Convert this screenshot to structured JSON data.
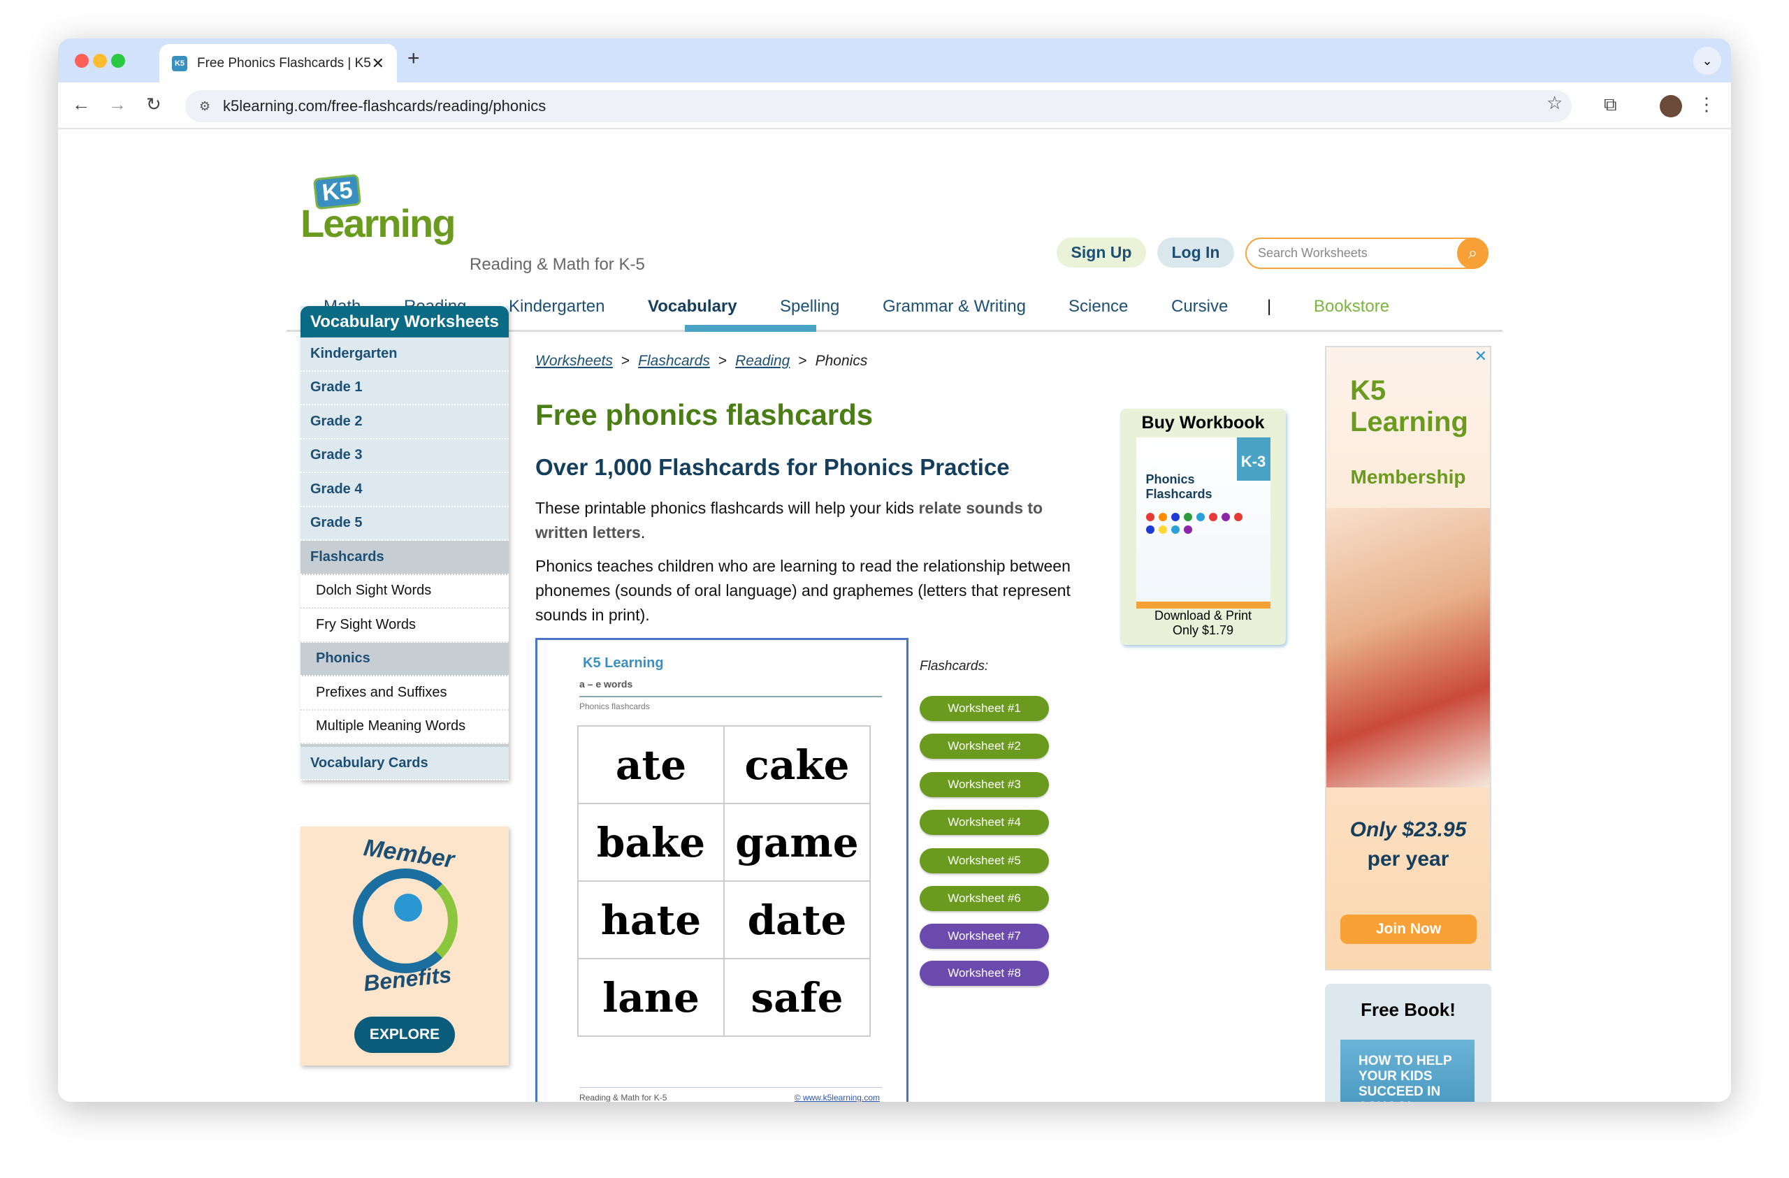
{
  "browser": {
    "tab_title": "Free Phonics Flashcards | K5",
    "url": "k5learning.com/free-flashcards/reading/phonics"
  },
  "header": {
    "logo_text": "K5 Learning",
    "tagline": "Reading & Math for K-5",
    "sign_up": "Sign Up",
    "log_in": "Log In",
    "search_placeholder": "Search Worksheets"
  },
  "nav": [
    "Math",
    "Reading",
    "Kindergarten",
    "Vocabulary",
    "Spelling",
    "Grammar & Writing",
    "Science",
    "Cursive",
    "|",
    "Bookstore"
  ],
  "nav_active": "Vocabulary",
  "sidebar": {
    "title": "Vocabulary Worksheets",
    "grades": [
      "Kindergarten",
      "Grade 1",
      "Grade 2",
      "Grade 3",
      "Grade 4",
      "Grade 5"
    ],
    "flashcards": "Flashcards",
    "sub": [
      "Dolch Sight Words",
      "Fry Sight Words",
      "Phonics",
      "Prefixes and Suffixes",
      "Multiple Meaning Words"
    ],
    "vocab_cards": "Vocabulary Cards"
  },
  "member": {
    "top": "Member",
    "bottom": "Benefits",
    "explore": "EXPLORE"
  },
  "breadcrumb": [
    "Worksheets",
    "Flashcards",
    "Reading",
    "Phonics"
  ],
  "main": {
    "title": "Free phonics flashcards",
    "subtitle": "Over 1,000 Flashcards for Phonics Practice",
    "p1_a": "These printable phonics flashcards will help your kids ",
    "p1_b": "relate sounds to written letters",
    "p1_c": ".",
    "p2": "Phonics teaches children who are learning to read the relationship between phonemes (sounds of oral language) and graphemes (letters that represent sounds in print)."
  },
  "sheet": {
    "logo": "K5 Learning",
    "title": "a – e words",
    "subtitle": "Phonics flashcards",
    "words": [
      "ate",
      "cake",
      "bake",
      "game",
      "hate",
      "date",
      "lane",
      "safe"
    ],
    "footer_left": "Reading & Math for K-5",
    "footer_right": "© www.k5learning.com"
  },
  "flashcards": {
    "label": "Flashcards:",
    "buttons": [
      "Worksheet #1",
      "Worksheet #2",
      "Worksheet #3",
      "Worksheet #4",
      "Worksheet #5",
      "Worksheet #6",
      "Worksheet #7",
      "Worksheet #8"
    ],
    "green": "#6a9b1e",
    "purple": "#6a4aad"
  },
  "workbook": {
    "title": "Buy Workbook",
    "grade": "K-3",
    "cover_title": "Phonics Flashcards",
    "line1": "Download & Print",
    "line2": "Only $1.79"
  },
  "ad": {
    "logo": "K5 Learning",
    "heading": "Membership",
    "price": "Only $23.95",
    "period": "per year",
    "cta": "Join Now"
  },
  "freebook": {
    "title": "Free Book!",
    "book": "HOW TO HELP YOUR KIDS SUCCEED IN SCHOOL"
  }
}
